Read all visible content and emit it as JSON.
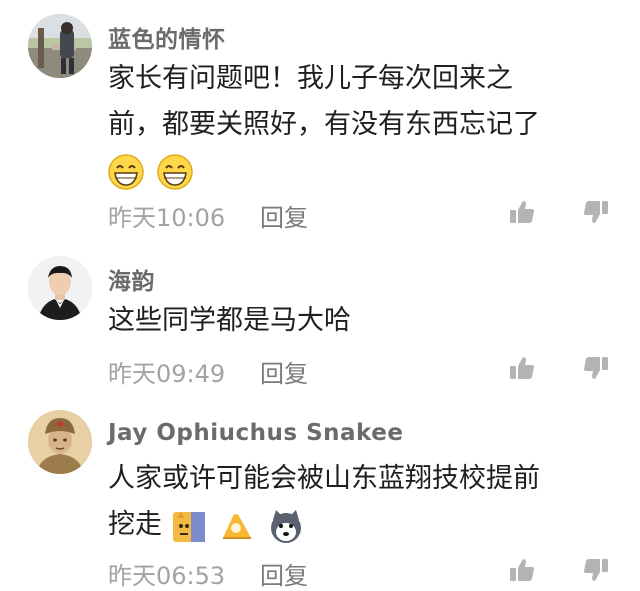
{
  "comments": [
    {
      "username": "蓝色的情怀",
      "lines": [
        "家长有问题吧！我儿子每次回来之",
        "前，都要关照好，有没有东西忘记了"
      ],
      "emojis": [
        "grin-emoji",
        "grin-emoji"
      ],
      "time": "昨天10:06",
      "reply_label": "回复"
    },
    {
      "username": "海韵",
      "lines": [
        "这些同学都是马大哈"
      ],
      "emojis": [],
      "time": "昨天09:49",
      "reply_label": "回复"
    },
    {
      "username": "Jay Ophiuchus Snakee",
      "lines": [
        "人家或许可能会被山东蓝翔技校提前",
        "挖走"
      ],
      "emojis": [
        "doge-emoji",
        "ok-hand-emoji",
        "husky-emoji"
      ],
      "time": "昨天06:53",
      "reply_label": "回复"
    }
  ],
  "colors": {
    "username": "#6b6b6b",
    "text": "#1f1f1f",
    "time": "#a3a3a3",
    "icon": "#b3b3b3"
  },
  "icons": {
    "like": "thumbs-up-icon",
    "dislike": "thumbs-down-icon"
  }
}
